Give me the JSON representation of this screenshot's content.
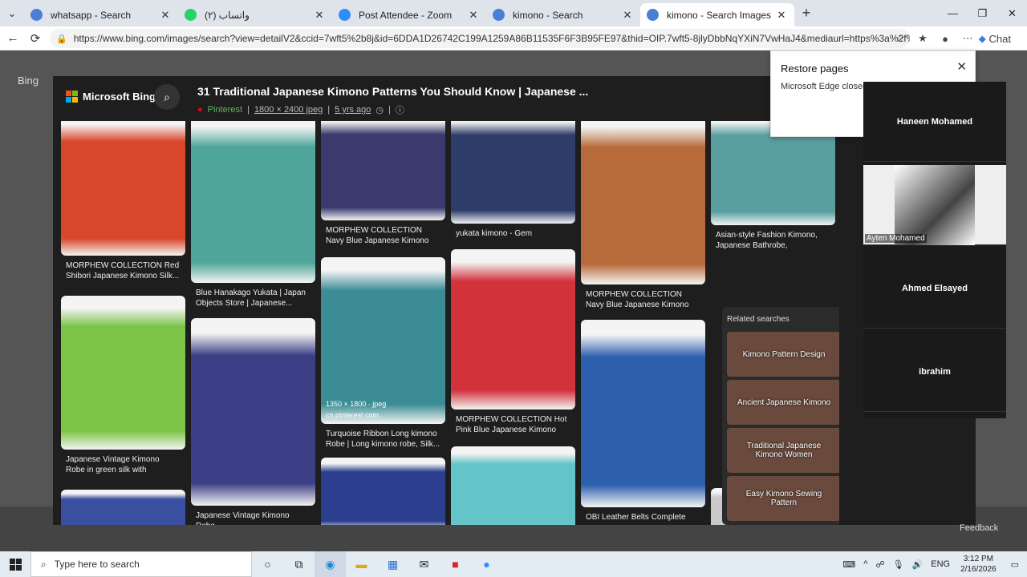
{
  "tabs": [
    {
      "title": "whatsapp - Search",
      "icon": "search-icon",
      "color": "#4a7fd6",
      "active": false
    },
    {
      "title": "واتساب (٢)",
      "icon": "whatsapp-icon",
      "color": "#25d366",
      "active": false
    },
    {
      "title": "Post Attendee - Zoom",
      "icon": "zoom-icon",
      "color": "#2d8cff",
      "active": false
    },
    {
      "title": "kimono - Search",
      "icon": "search-icon",
      "color": "#4a7fd6",
      "active": false
    },
    {
      "title": "kimono - Search Images",
      "icon": "search-icon",
      "color": "#4a7fd6",
      "active": true
    }
  ],
  "address": {
    "url": "https://www.bing.com/images/search?view=detailV2&ccid=7wft5%2b8j&id=6DDA1D26742C199A1259A86B11535F6F3B95FE97&thid=OIP.7wft5-8jlyDbbNqYXiN7VwHaJ4&mediaurl=https%3a%2f%2fi.pin...",
    "chat_label": "Chat"
  },
  "background": {
    "logo": "Bing"
  },
  "viewer": {
    "brand": "Microsoft Bing",
    "title": "31 Traditional Japanese Kimono Patterns You Should Know | Japanese ...",
    "source": "Pinterest",
    "dimensions": "1800 × 2400 jpeg",
    "age": "5 yrs ago"
  },
  "cards": [
    {
      "caption": "MORPHEW COLLECTION Red Shibori Japanese Kimono Silk...",
      "color": "#d9472b"
    },
    {
      "caption": "Japanese Vintage Kimono Robe in green silk with Obijime...",
      "color": "#7cc447"
    },
    {
      "caption": "",
      "color": "#3a4fa0"
    },
    {
      "caption": "Blue Hanakago Yukata | Japan Objects Store | Japanese...",
      "color": "#4fa59a"
    },
    {
      "caption": "Japanese Vintage Kimono Robe",
      "color": "#3c3f86"
    },
    {
      "caption": "MORPHEW COLLECTION Navy Blue Japanese Kimono Silk Flor...",
      "color": "#3b3a6e"
    },
    {
      "caption": "Turquoise Ribbon Long kimono Robe | Long kimono robe, Silk...",
      "color": "#3b8c94",
      "overlay_dims": "1350 × 1800 · jpeg",
      "overlay_src": "co.pinterest.com"
    },
    {
      "caption": "",
      "color": "#2b3f8e"
    },
    {
      "caption": "yukata kimono - Gem",
      "color": "#2e3c6a"
    },
    {
      "caption": "MORPHEW COLLECTION Hot Pink Blue Japanese Kimono Silk...",
      "color": "#d2333b"
    },
    {
      "caption": "",
      "color": "#63c5c9"
    },
    {
      "caption": "MORPHEW COLLECTION Navy Blue Japanese Kimono Silk Flor...",
      "color": "#b86b3a"
    },
    {
      "caption": "OBI Leather Belts Complete",
      "color": "#2c5fae"
    },
    {
      "caption": "Asian-style Fashion Kimono, Japanese Bathrobe, Seductive...",
      "color": "#5a9fa0"
    },
    {
      "caption": "",
      "color": "#c9c9c9"
    }
  ],
  "related": {
    "title": "Related searches",
    "items": [
      "Kimono Pattern Design",
      "Ancient Japanese Kimono",
      "Traditional Japanese Kimono Women",
      "Easy Kimono Sewing Pattern"
    ]
  },
  "restore": {
    "title": "Restore pages",
    "message": "Microsoft Edge closed"
  },
  "zoom_participants": [
    {
      "name": "Haneen Mohamed",
      "label": ""
    },
    {
      "name": "",
      "label": "Ayten Mohamed"
    },
    {
      "name": "Ahmed Elsayed",
      "label": ""
    },
    {
      "name": "ibrahim",
      "label": ""
    }
  ],
  "feedback": "Feedback",
  "taskbar": {
    "search_placeholder": "Type here to search",
    "lang": "ENG",
    "time": "3:12 PM",
    "date": "2/16/2026"
  }
}
